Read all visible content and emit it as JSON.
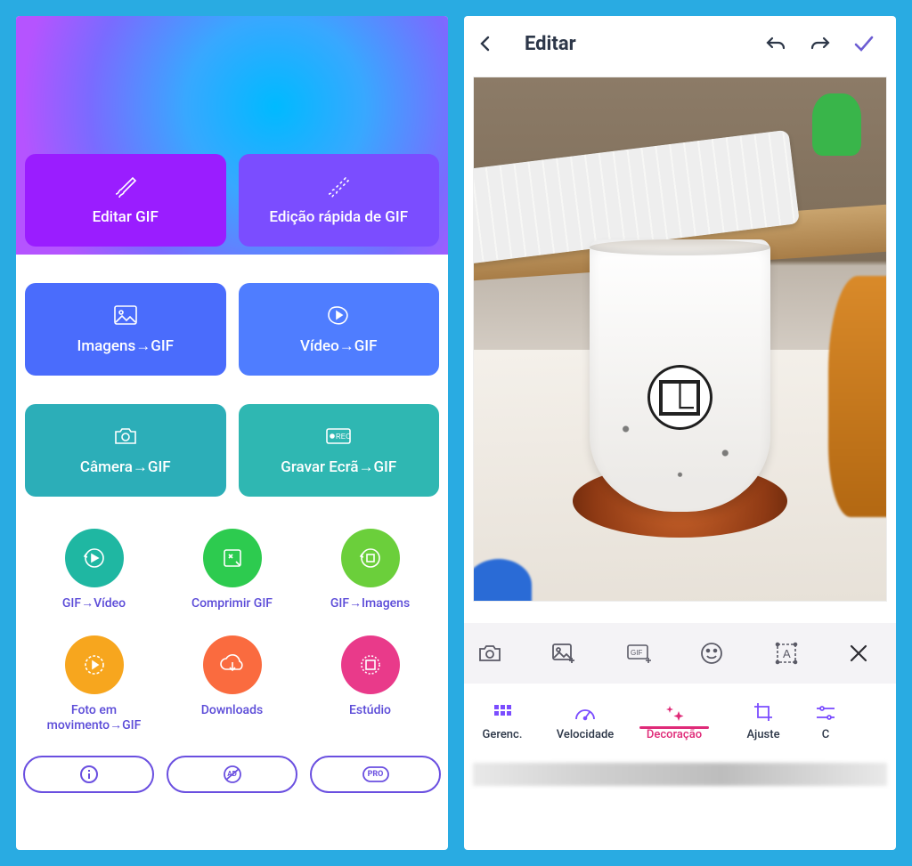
{
  "left": {
    "hero": {
      "edit": "Editar GIF",
      "quick": "Edição rápida de GIF"
    },
    "cards": [
      {
        "label": "Imagens→GIF"
      },
      {
        "label": "Vídeo→GIF"
      },
      {
        "label": "Câmera→GIF"
      },
      {
        "label": "Gravar Ecrã→GIF"
      }
    ],
    "circles": [
      {
        "label": "GIF→Vídeo"
      },
      {
        "label": "Comprimir GIF"
      },
      {
        "label": "GIF→Imagens"
      },
      {
        "label": "Foto em movimento→GIF"
      },
      {
        "label": "Downloads"
      },
      {
        "label": "Estúdio"
      }
    ],
    "pills": {
      "ad": "AD",
      "pro": "PRO"
    }
  },
  "right": {
    "title": "Editar",
    "tabs": {
      "manage": "Gerenc.",
      "speed": "Velocidade",
      "decor": "Decoração",
      "adjust": "Ajuste",
      "crop_initial": "C"
    },
    "cup_logo": "⎿"
  }
}
